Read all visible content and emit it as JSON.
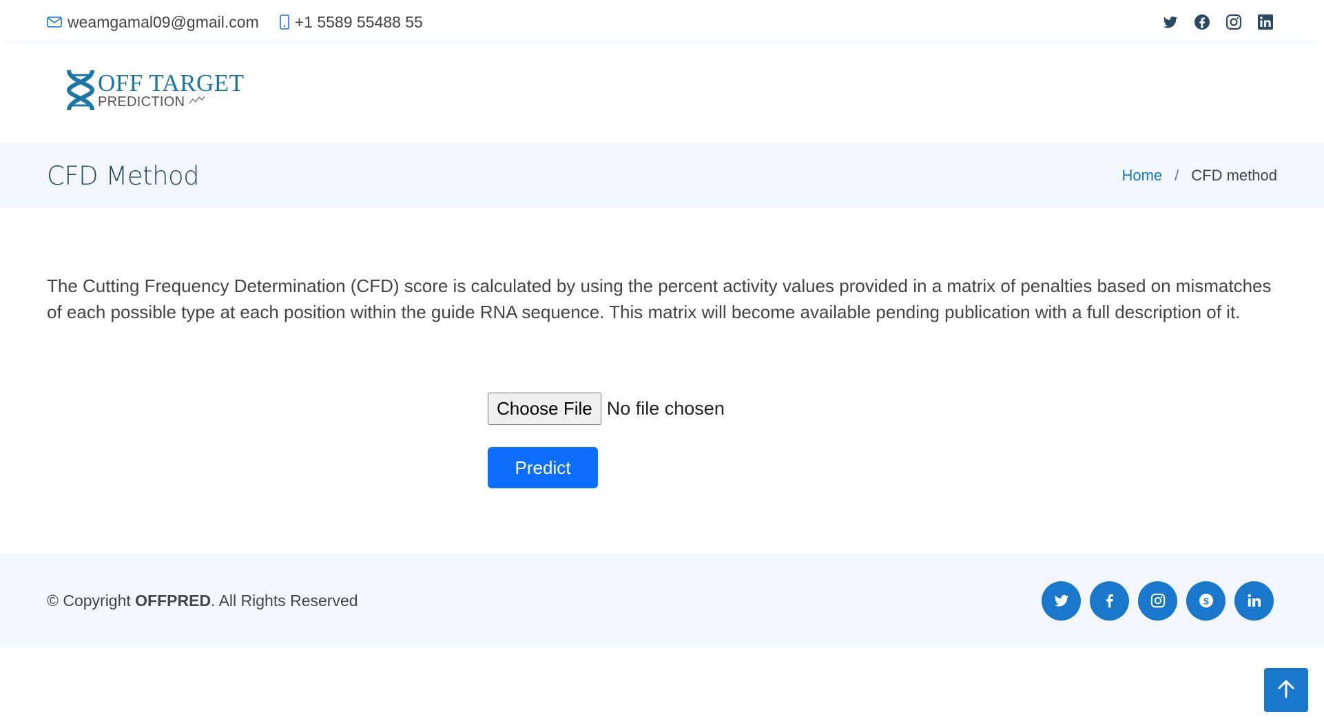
{
  "topbar": {
    "email": "weamgamal09@gmail.com",
    "phone": "+1 5589 55488 55",
    "social_icons": [
      "twitter-icon",
      "facebook-icon",
      "instagram-icon",
      "linkedin-icon"
    ]
  },
  "logo": {
    "title": "OFF TARGET",
    "subtitle": "PREDICTION"
  },
  "breadcrumbs": {
    "title": "CFD Method",
    "home": "Home",
    "separator": "/",
    "current": "CFD method"
  },
  "main": {
    "description": "The Cutting Frequency Determination (CFD) score is calculated by using the percent activity values provided in a matrix of penalties based on mismatches of each possible type at each position within the guide RNA sequence. This matrix will become available pending publication with a full description of it.",
    "file_button": "Choose File",
    "file_status": "No file chosen",
    "predict_button": "Predict"
  },
  "footer": {
    "copyright_prefix": "© Copyright ",
    "brand": "OFFPRED",
    "copyright_suffix": ". All Rights Reserved",
    "social_icons": [
      "twitter-icon",
      "facebook-icon",
      "instagram-icon",
      "skype-icon",
      "linkedin-icon"
    ]
  },
  "colors": {
    "accent": "#1977cc",
    "button": "#0d6efd",
    "band_bg": "#f1f7fd",
    "heading": "#2c4964"
  }
}
